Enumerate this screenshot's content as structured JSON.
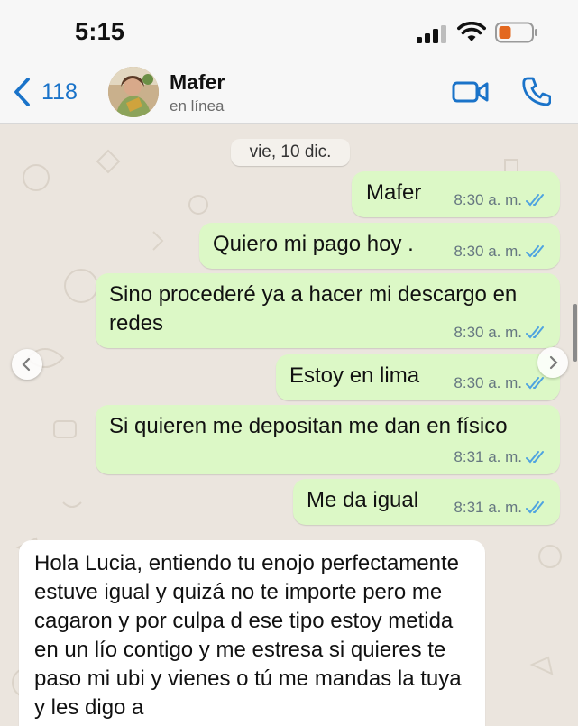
{
  "status_bar": {
    "time": "5:15"
  },
  "header": {
    "back_count": "118",
    "contact_name": "Mafer",
    "presence": "en línea"
  },
  "chat": {
    "date_label": "vie, 10 dic.",
    "messages": [
      {
        "dir": "out",
        "text": "Mafer",
        "time": "8:30 a. m."
      },
      {
        "dir": "out",
        "text": "Quiero mi pago hoy .",
        "time": "8:30 a. m."
      },
      {
        "dir": "out",
        "text": "Sino procederé ya a hacer mi descargo en redes",
        "time": "8:30 a. m."
      },
      {
        "dir": "out",
        "text": "Estoy en lima",
        "time": "8:30 a. m."
      },
      {
        "dir": "out",
        "text": "Si quieren me depositan me dan en físico",
        "time": "8:31 a. m."
      },
      {
        "dir": "out",
        "text": "Me da igual",
        "time": "8:31 a. m."
      },
      {
        "dir": "in",
        "text": "Hola Lucia, entiendo tu enojo perfectamente estuve igual y quizá no te importe pero me cagaron y por culpa d ese tipo estoy metida en un lío contigo y me estresa si quieres te paso mi ubi y vienes o tú me mandas la tuya y les digo a"
      }
    ]
  },
  "colors": {
    "accent": "#1a73c9",
    "outgoing_bubble": "#dcf8c6",
    "incoming_bubble": "#ffffff",
    "chat_background": "#ebe5de",
    "read_ticks": "#4fa3e0",
    "battery_level": "#e3681f"
  },
  "icons": [
    "signal-icon",
    "wifi-icon",
    "battery-icon",
    "back-chevron-icon",
    "video-call-icon",
    "phone-icon",
    "read-receipt-icon",
    "scroll-left-icon",
    "scroll-right-icon"
  ]
}
